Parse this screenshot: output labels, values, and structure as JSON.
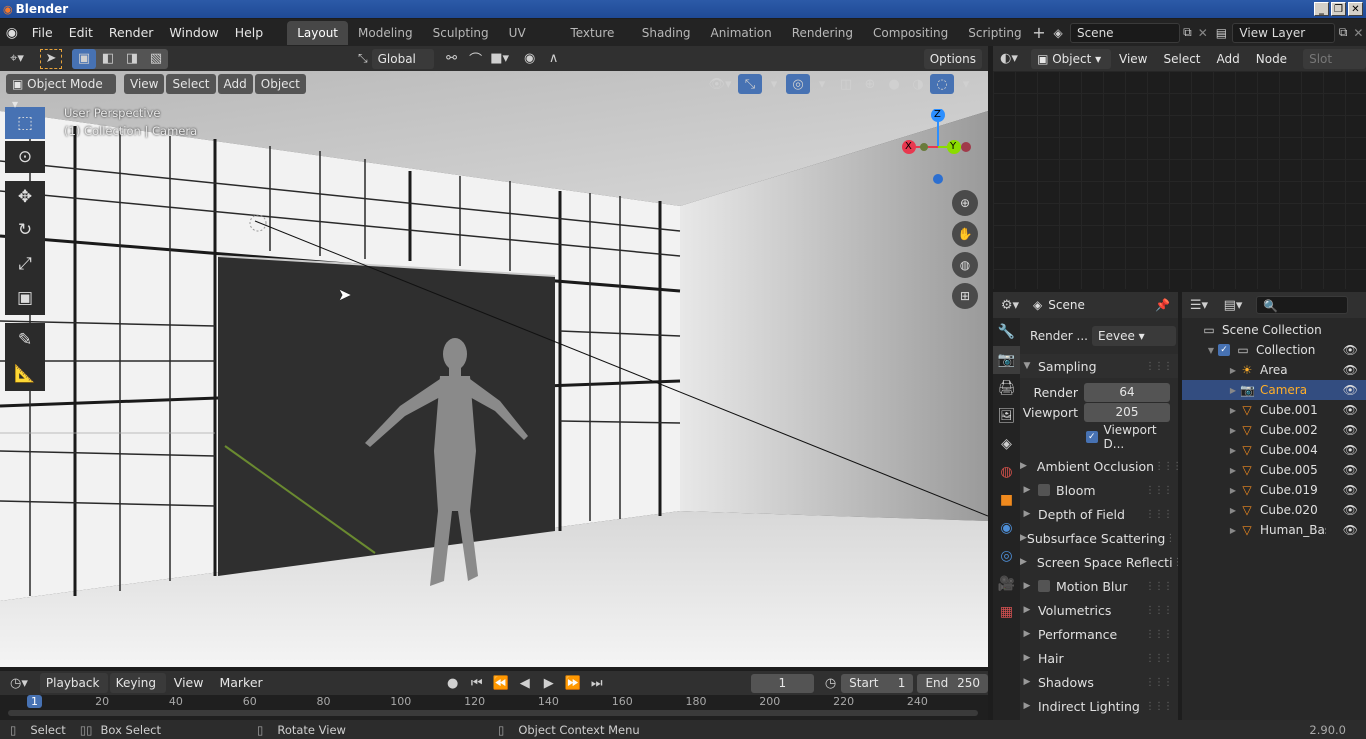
{
  "window": {
    "title": "Blender"
  },
  "menus": [
    "File",
    "Edit",
    "Render",
    "Window",
    "Help"
  ],
  "workspaces": [
    "Layout",
    "Modeling",
    "Sculpting",
    "UV Editing",
    "Texture Paint",
    "Shading",
    "Animation",
    "Rendering",
    "Compositing",
    "Scripting"
  ],
  "scene": {
    "label": "Scene",
    "view_layer": "View Layer"
  },
  "viewport_header": {
    "orientation": "Global",
    "options": "Options",
    "mode": "Object Mode",
    "menus": [
      "View",
      "Select",
      "Add",
      "Object"
    ],
    "perspective": "User Perspective",
    "collection_info": "(1) Collection | Camera"
  },
  "gizmo": {
    "x": "X",
    "y": "Y",
    "z": "Z"
  },
  "node_editor": {
    "mode": "Object",
    "menus": [
      "View",
      "Select",
      "Add",
      "Node"
    ],
    "slot": "Slot"
  },
  "properties": {
    "context": "Scene",
    "render_engine_label": "Render ...",
    "render_engine": "Eevee",
    "sampling": "Sampling",
    "render_label": "Render",
    "render_value": "64",
    "viewport_label": "Viewport",
    "viewport_value": "205",
    "viewport_denoise": "Viewport D...",
    "panels": [
      {
        "label": "Ambient Occlusion",
        "checkbox": true
      },
      {
        "label": "Bloom",
        "checkbox": true
      },
      {
        "label": "Depth of Field",
        "checkbox": false
      },
      {
        "label": "Subsurface Scattering",
        "checkbox": false
      },
      {
        "label": "Screen Space Reflecti",
        "checkbox": true
      },
      {
        "label": "Motion Blur",
        "checkbox": true
      },
      {
        "label": "Volumetrics",
        "checkbox": false
      },
      {
        "label": "Performance",
        "checkbox": false
      },
      {
        "label": "Hair",
        "checkbox": false
      },
      {
        "label": "Shadows",
        "checkbox": false
      },
      {
        "label": "Indirect Lighting",
        "checkbox": false
      }
    ]
  },
  "outliner": {
    "root": "Scene Collection",
    "collection": "Collection",
    "items": [
      {
        "name": "Area",
        "icon": "light-icon",
        "selected": false
      },
      {
        "name": "Camera",
        "icon": "camera-icon",
        "selected": true
      },
      {
        "name": "Cube.001",
        "icon": "mesh-icon",
        "selected": false
      },
      {
        "name": "Cube.002",
        "icon": "mesh-icon",
        "selected": false
      },
      {
        "name": "Cube.004",
        "icon": "mesh-icon",
        "selected": false
      },
      {
        "name": "Cube.005",
        "icon": "mesh-icon",
        "selected": false
      },
      {
        "name": "Cube.019",
        "icon": "mesh-icon",
        "selected": false
      },
      {
        "name": "Cube.020",
        "icon": "mesh-icon",
        "selected": false
      },
      {
        "name": "Human_BaseM",
        "icon": "mesh-icon",
        "selected": false
      }
    ]
  },
  "timeline": {
    "menus": [
      "Playback",
      "Keying",
      "View",
      "Marker"
    ],
    "current_frame": "1",
    "start_label": "Start",
    "start": "1",
    "end_label": "End",
    "end": "250",
    "ticks": [
      "1",
      "20",
      "40",
      "60",
      "80",
      "100",
      "120",
      "140",
      "160",
      "180",
      "200",
      "220",
      "240"
    ]
  },
  "status": {
    "select": "Select",
    "box_select": "Box Select",
    "rotate_view": "Rotate View",
    "context_menu": "Object Context Menu",
    "version": "2.90.0"
  },
  "colors": {
    "accent": "#4772b3",
    "selected_name": "#ffaf29",
    "x_axis": "#e8384f",
    "y_axis": "#8bdc00",
    "z_axis": "#2c8fff"
  }
}
